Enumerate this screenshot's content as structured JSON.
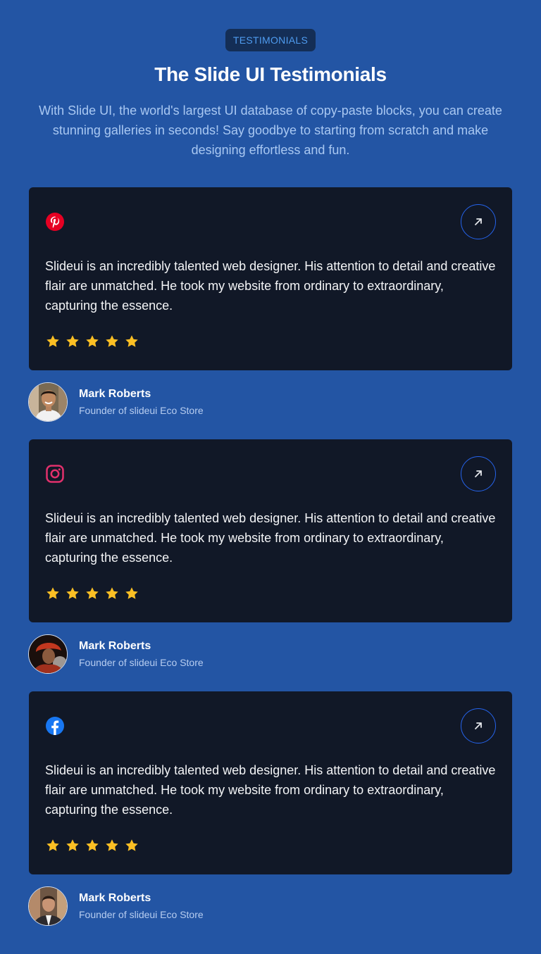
{
  "header": {
    "badge": "TESTIMONIALS",
    "title": "The Slide UI Testimonials",
    "subtitle": "With Slide UI, the world's largest UI database of copy-paste blocks, you can create stunning galleries in seconds! Say goodbye to starting from scratch and make designing effortless and fun."
  },
  "colors": {
    "background": "#2355a4",
    "card": "#111827",
    "star": "#fbbf24",
    "accent": "#2563eb"
  },
  "testimonials": [
    {
      "platform_icon": "pinterest-icon",
      "quote": "Slideui is an incredibly talented web designer. His attention to detail and creative flair are unmatched. He took my website from ordinary to extraordinary, capturing the essence.",
      "rating": 5,
      "name": "Mark Roberts",
      "role": "Founder of slideui Eco Store"
    },
    {
      "platform_icon": "instagram-icon",
      "quote": "Slideui is an incredibly talented web designer. His attention to detail and creative flair are unmatched. He took my website from ordinary to extraordinary, capturing the essence.",
      "rating": 5,
      "name": "Mark Roberts",
      "role": "Founder of slideui Eco Store"
    },
    {
      "platform_icon": "facebook-icon",
      "quote": "Slideui is an incredibly talented web designer. His attention to detail and creative flair are unmatched. He took my website from ordinary to extraordinary, capturing the essence.",
      "rating": 5,
      "name": "Mark Roberts",
      "role": "Founder of slideui Eco Store"
    }
  ]
}
